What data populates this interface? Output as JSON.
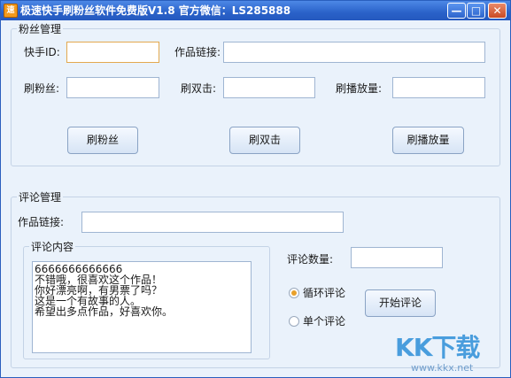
{
  "window": {
    "title": "极速快手刷粉丝软件免费版V1.8 官方微信：LS285888"
  },
  "titlebar": {
    "minimize": "—",
    "maximize": "□",
    "close": "✕"
  },
  "fans_section": {
    "legend": "粉丝管理",
    "kuaishou_id_label": "快手ID:",
    "kuaishou_id_value": "",
    "work_link_label": "作品链接:",
    "work_link_value": "",
    "fans_label": "刷粉丝:",
    "fans_value": "",
    "double_click_label": "刷双击:",
    "double_click_value": "",
    "plays_label": "刷播放量:",
    "plays_value": "",
    "fans_button": "刷粉丝",
    "double_click_button": "刷双击",
    "plays_button": "刷播放量"
  },
  "comment_section": {
    "legend": "评论管理",
    "work_link_label": "作品链接:",
    "work_link_value": "",
    "content_legend": "评论内容",
    "content_lines": [
      "6666666666666",
      "不错哦，很喜欢这个作品！",
      "你好漂亮啊，有男票了吗？",
      "这是一个有故事的人。",
      "希望出多点作品，好喜欢你。"
    ],
    "count_label": "评论数量:",
    "count_value": "",
    "loop_radio_label": "循环评论",
    "single_radio_label": "单个评论",
    "selected_mode": "循环评论",
    "start_button": "开始评论"
  },
  "watermark": {
    "logo": "KK下载",
    "url": "www.kkx.net"
  }
}
